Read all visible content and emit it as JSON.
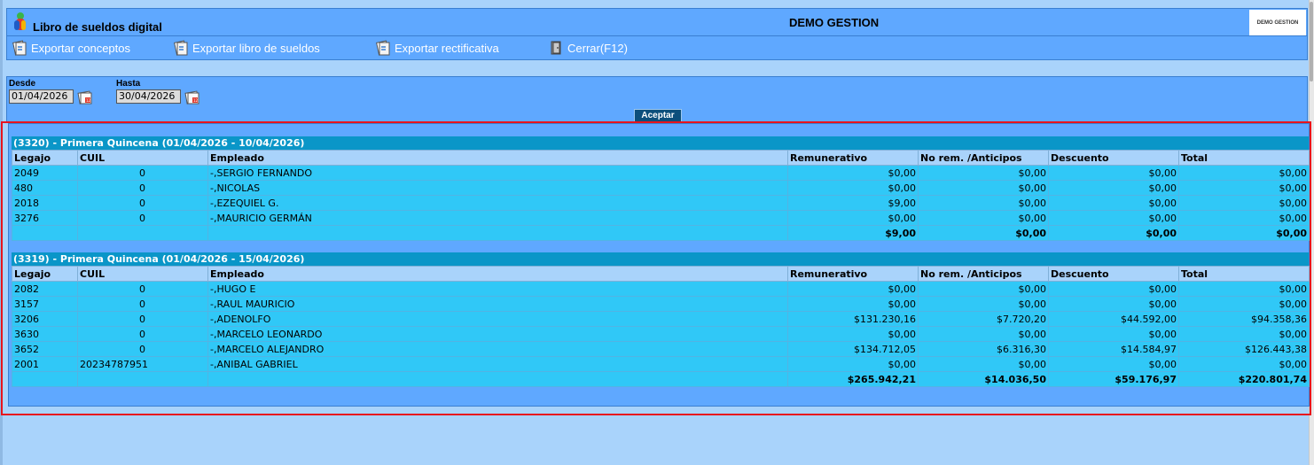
{
  "app": {
    "title": "Libro de sueldos digital",
    "company": "DEMO GESTION",
    "brand": "DEMO GESTION"
  },
  "toolbar": {
    "items": [
      {
        "label": "Exportar conceptos",
        "icon": "export-icon"
      },
      {
        "label": "Exportar libro de sueldos",
        "icon": "export-icon"
      },
      {
        "label": "Exportar rectificativa",
        "icon": "export-icon"
      },
      {
        "label": "Cerrar(F12)",
        "icon": "close-door-icon"
      }
    ]
  },
  "filters": {
    "desde_label": "Desde",
    "desde_value": "01/04/2026",
    "hasta_label": "Hasta",
    "hasta_value": "30/04/2026",
    "accept_label": "Aceptar"
  },
  "columns": [
    "Legajo",
    "CUIL",
    "Empleado",
    "Remunerativo",
    "No rem. /Anticipos",
    "Descuento",
    "Total"
  ],
  "groups": [
    {
      "title": "(3320) - Primera Quincena (01/04/2026 - 10/04/2026)",
      "rows": [
        [
          "2049",
          "0",
          "-,SERGIO FERNANDO",
          "$0,00",
          "$0,00",
          "$0,00",
          "$0,00"
        ],
        [
          "480",
          "0",
          "-,NICOLAS",
          "$0,00",
          "$0,00",
          "$0,00",
          "$0,00"
        ],
        [
          "2018",
          "0",
          "-,EZEQUIEL G.",
          "$9,00",
          "$0,00",
          "$0,00",
          "$0,00"
        ],
        [
          "3276",
          "0",
          "-,MAURICIO GERMÁN",
          "$0,00",
          "$0,00",
          "$0,00",
          "$0,00"
        ]
      ],
      "totals": [
        "$9,00",
        "$0,00",
        "$0,00",
        "$0,00"
      ]
    },
    {
      "title": "(3319) - Primera Quincena (01/04/2026 - 15/04/2026)",
      "rows": [
        [
          "2082",
          "0",
          "-,HUGO E",
          "$0,00",
          "$0,00",
          "$0,00",
          "$0,00"
        ],
        [
          "3157",
          "0",
          "-,RAUL MAURICIO",
          "$0,00",
          "$0,00",
          "$0,00",
          "$0,00"
        ],
        [
          "3206",
          "0",
          "-,ADENOLFO",
          "$131.230,16",
          "$7.720,20",
          "$44.592,00",
          "$94.358,36"
        ],
        [
          "3630",
          "0",
          "-,MARCELO LEONARDO",
          "$0,00",
          "$0,00",
          "$0,00",
          "$0,00"
        ],
        [
          "3652",
          "0",
          "-,MARCELO ALEJANDRO",
          "$134.712,05",
          "$6.316,30",
          "$14.584,97",
          "$126.443,38"
        ],
        [
          "2001",
          "20234787951",
          "-,ANIBAL GABRIEL",
          "$0,00",
          "$0,00",
          "$0,00",
          "$0,00"
        ]
      ],
      "totals": [
        "$265.942,21",
        "$14.036,50",
        "$59.176,97",
        "$220.801,74"
      ]
    }
  ]
}
